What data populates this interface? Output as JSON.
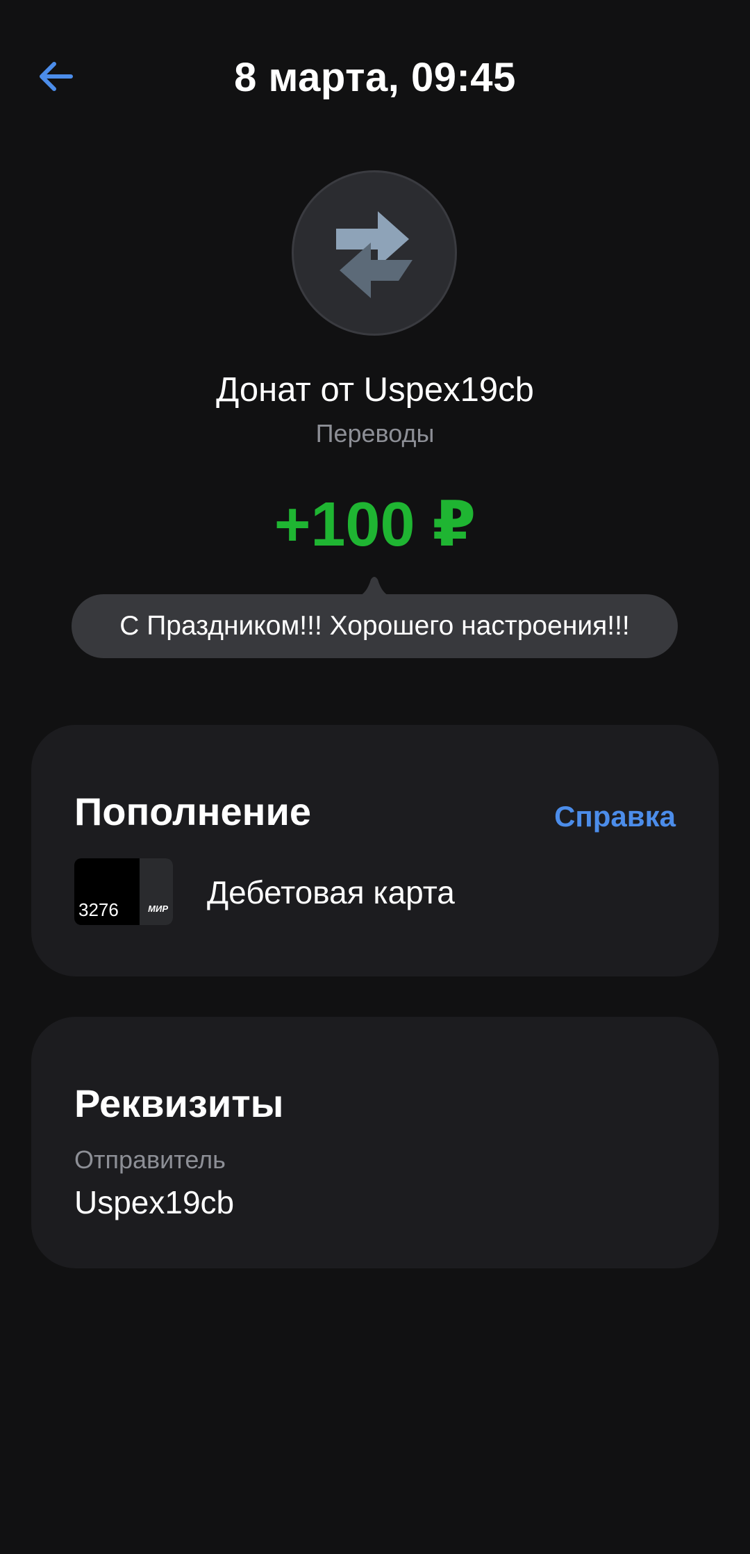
{
  "header": {
    "title": "8 марта, 09:45",
    "back_icon": "arrow-left-icon",
    "accent_color": "#4c8dea"
  },
  "transaction": {
    "icon": "transfer-arrows-icon",
    "title": "Донат от Uspex19cb",
    "category": "Переводы",
    "amount": "+100 ₽",
    "amount_color": "#1fb532",
    "message": "С Праздником!!! Хорошего настроения!!!"
  },
  "topup": {
    "heading": "Пополнение",
    "help_label": "Справка",
    "card_last_digits": "3276",
    "card_brand": "МИР",
    "card_type": "Дебетовая карта"
  },
  "requisites": {
    "heading": "Реквизиты",
    "sender_label": "Отправитель",
    "sender_value": "Uspex19cb"
  }
}
